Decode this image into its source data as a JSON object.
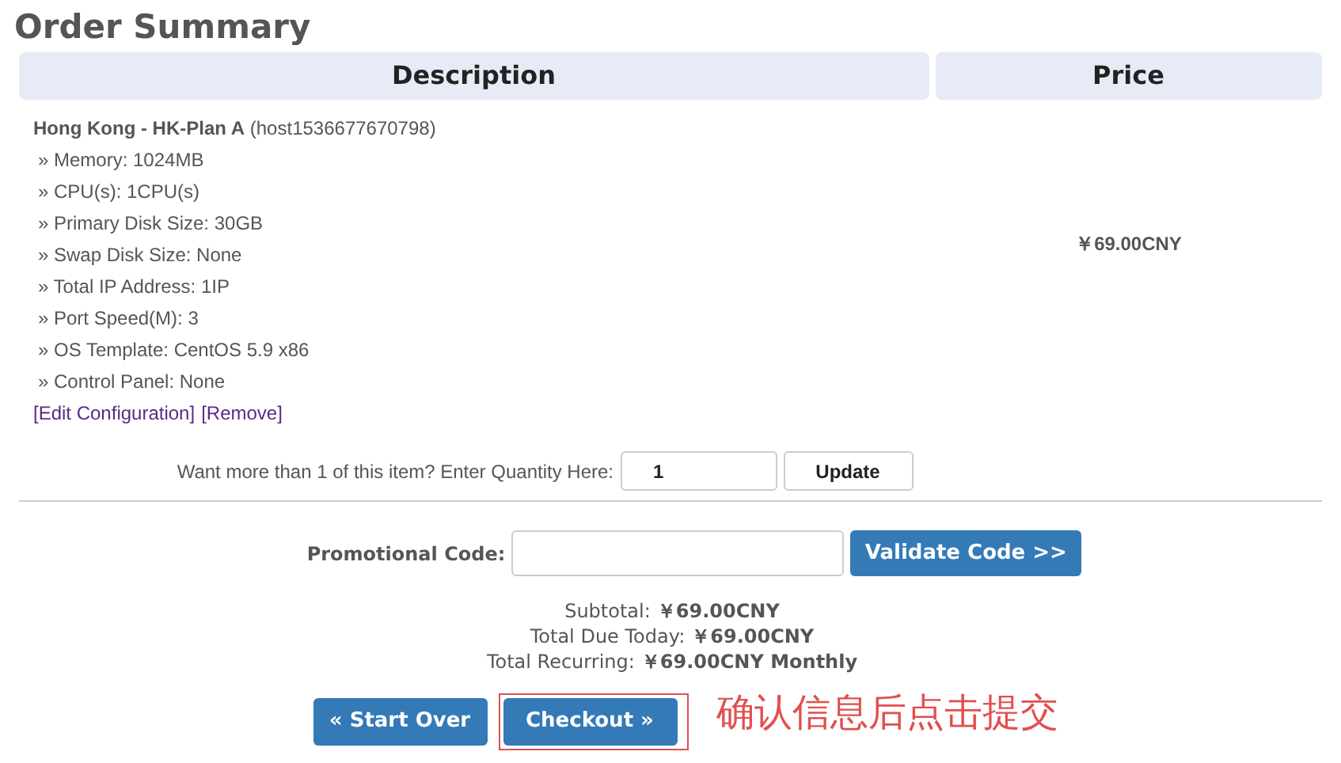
{
  "title": "Order Summary",
  "table": {
    "columns": [
      "Description",
      "Price"
    ],
    "item": {
      "name": "Hong Kong - HK-Plan A",
      "host": "(host1536677670798)",
      "options": [
        "» Memory: 1024MB",
        "» CPU(s): 1CPU(s)",
        "» Primary Disk Size: 30GB",
        "» Swap Disk Size: None",
        "» Total IP Address: 1IP",
        "» Port Speed(M): 3",
        "» OS Template: CentOS 5.9 x86",
        "» Control Panel: None"
      ],
      "links": [
        "[Edit Configuration]",
        "[Remove]"
      ],
      "price": "￥69.00CNY"
    },
    "quantity": {
      "label": "Want more than 1 of this item? Enter Quantity Here:",
      "value": "1",
      "button": "Update"
    }
  },
  "promo": {
    "label": "Promotional Code:",
    "button": "Validate Code >>"
  },
  "totals": [
    {
      "label": "Subtotal:",
      "value": "￥69.00CNY"
    },
    {
      "label": "Total Due Today:",
      "value": "￥69.00CNY"
    },
    {
      "label": "Total Recurring:",
      "value": "￥69.00CNY Monthly"
    }
  ],
  "buttons": [
    {
      "label": "« Start Over",
      "highlighted": false
    },
    {
      "label": "Checkout »",
      "highlighted": true
    }
  ],
  "annotation": "确认信息后点击提交"
}
